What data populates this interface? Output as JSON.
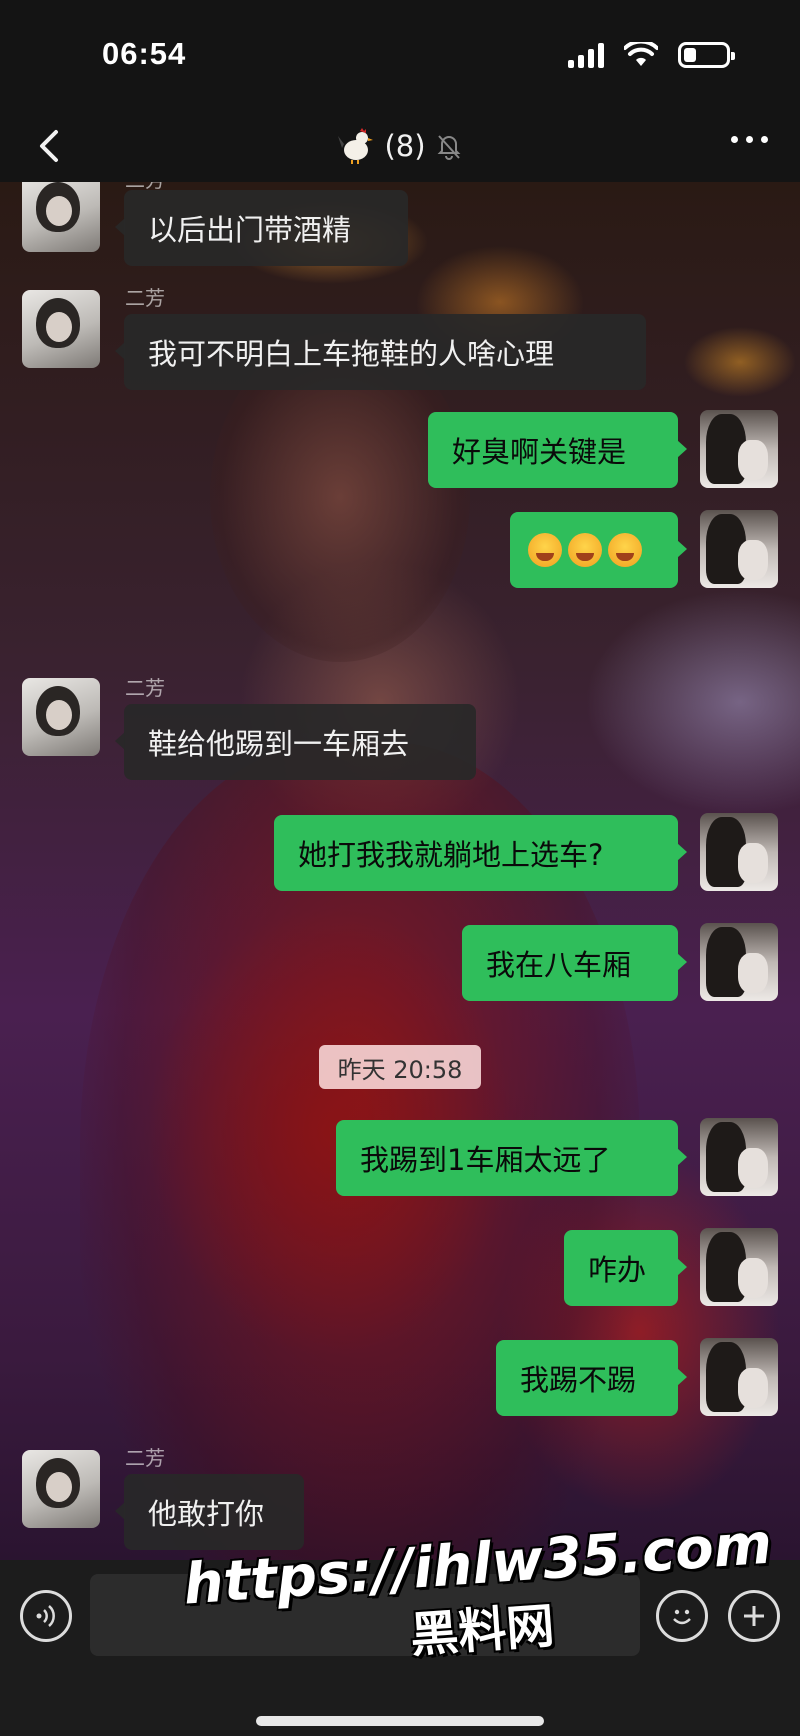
{
  "status_bar": {
    "time": "06:54",
    "battery_level": 0.3
  },
  "header": {
    "title": "(8)",
    "title_icon": "rooster-emoji",
    "mute_icon": "bell-slash-icon"
  },
  "messages": [
    {
      "side": "in",
      "sender": "二芳",
      "text": "以后出门带酒精"
    },
    {
      "side": "in",
      "sender": "二芳",
      "text": "我可不明白上车拖鞋的人啥心理"
    },
    {
      "side": "out",
      "text": "好臭啊关键是"
    },
    {
      "side": "out",
      "text": "",
      "emoji": [
        "rolling-laughing-emoji",
        "rolling-laughing-emoji",
        "rolling-laughing-emoji"
      ]
    },
    {
      "side": "in",
      "sender": "二芳",
      "text": "鞋给他踢到一车厢去"
    },
    {
      "side": "out",
      "text": "她打我我就躺地上选车?"
    },
    {
      "side": "out",
      "text": "我在八车厢"
    },
    {
      "side": "out",
      "text": "我踢到1车厢太远了"
    },
    {
      "side": "out",
      "text": "咋办"
    },
    {
      "side": "out",
      "text": "我踢不踢"
    },
    {
      "side": "in",
      "sender": "二芳",
      "text": "他敢打你"
    }
  ],
  "timestamp": "昨天 20:58",
  "input_bar": {
    "placeholder": ""
  },
  "watermark": {
    "line1": "https://ihlw35.com",
    "line2": "黑料网"
  },
  "colors": {
    "out_bubble": "#2fbe5b",
    "in_bubble": "#282828",
    "timestamp_bg": "#ffe1e1"
  }
}
